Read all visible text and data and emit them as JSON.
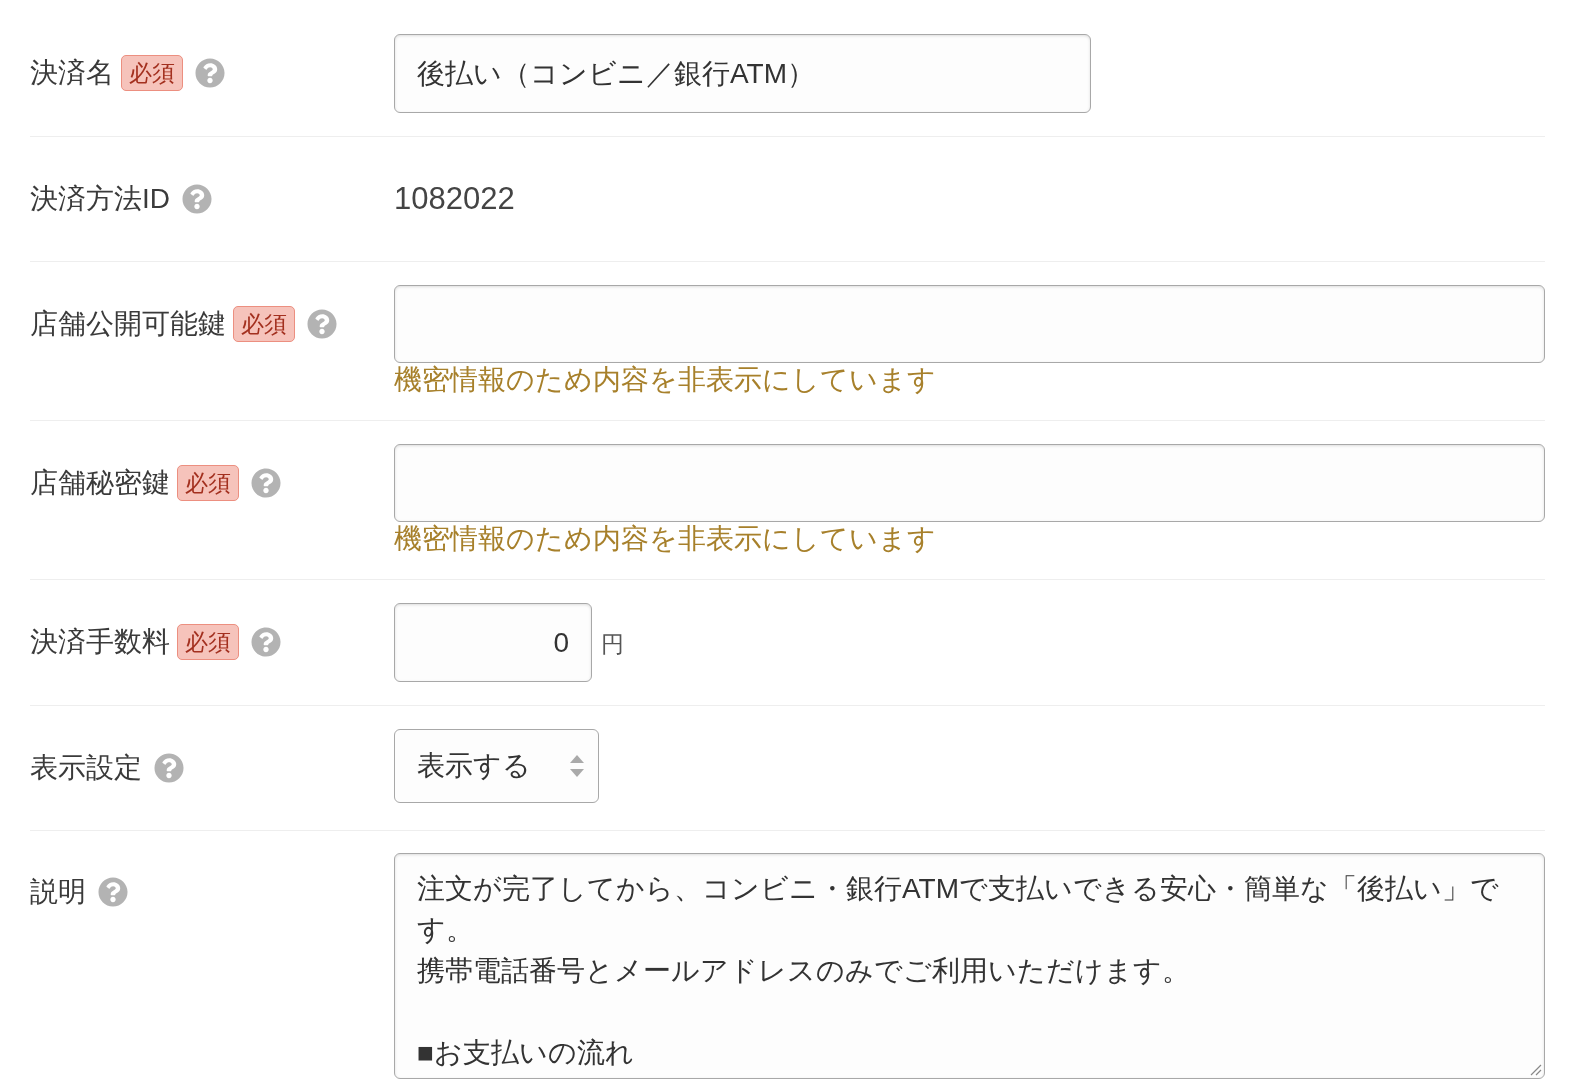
{
  "form": {
    "rows": [
      {
        "kind": "text",
        "label": "決済名",
        "badge": "必須",
        "value": "後払い（コンビニ／銀行ATM）"
      },
      {
        "kind": "static",
        "label": "決済方法ID",
        "value": "1082022"
      },
      {
        "kind": "secret",
        "label": "店舗公開可能鍵",
        "badge": "必須",
        "hint": "機密情報のため内容を非表示にしています"
      },
      {
        "kind": "secret",
        "label": "店舗秘密鍵",
        "badge": "必須",
        "hint": "機密情報のため内容を非表示にしています"
      },
      {
        "kind": "number",
        "label": "決済手数料",
        "badge": "必須",
        "value": "0",
        "unit": "円"
      },
      {
        "kind": "select",
        "label": "表示設定",
        "value": "表示する"
      },
      {
        "kind": "textarea",
        "label": "説明",
        "paragraphs": [
          {
            "lines": [
              "注文が完了してから、コンビニ・銀行ATMで支払いできる安心・簡単な「後払い」です。",
              "携帯電話番号とメールアドレスのみでご利用いただけます。"
            ]
          },
          {
            "lines": [
              "■お支払いの流れ"
            ]
          }
        ]
      }
    ]
  }
}
